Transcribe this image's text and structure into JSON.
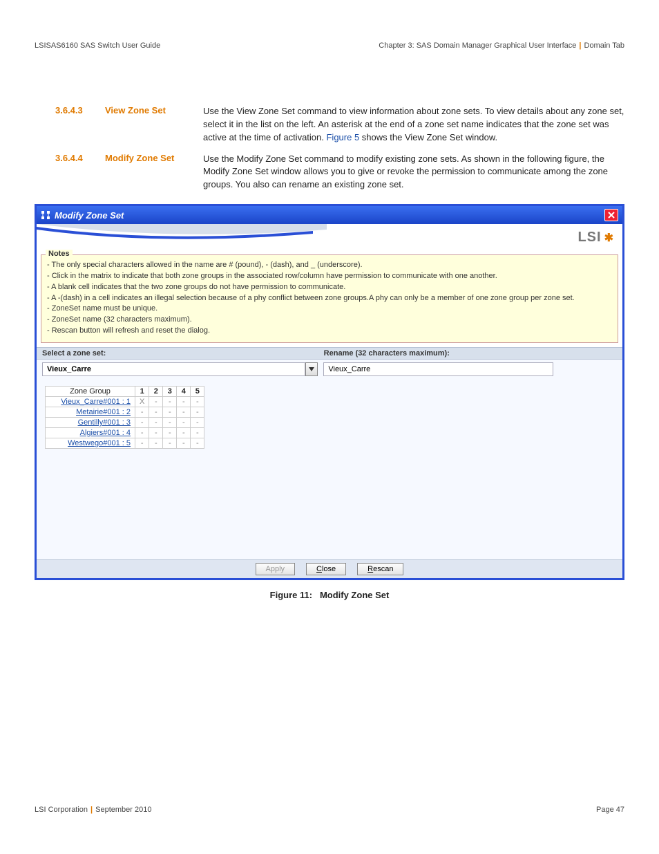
{
  "header": {
    "left": "LSISAS6160 SAS Switch User Guide",
    "right_chapter": "Chapter 3: SAS Domain Manager Graphical User Interface",
    "right_section": "Domain Tab"
  },
  "sections": [
    {
      "num": "3.6.4.3",
      "title": "View Zone Set",
      "body_pre": "Use the View Zone Set command to view information about zone sets. To view details about any zone set, select it in the list on the left. An asterisk at the end of a zone set name indicates that the zone set was active at the time of activation. ",
      "link": "Figure 5",
      "body_post": " shows the View Zone Set window."
    },
    {
      "num": "3.6.4.4",
      "title": "Modify Zone Set",
      "body_pre": "Use the Modify Zone Set command to modify existing zone sets. As shown in the following figure, the Modify Zone Set window allows you to give or revoke the permission to communicate among the zone groups. You also can rename an existing zone set.",
      "link": "",
      "body_post": ""
    }
  ],
  "dialog": {
    "title": "Modify Zone Set",
    "brand": "LSI",
    "notes_legend": "Notes",
    "notes": [
      "- The only special characters allowed in the name are # (pound), - (dash), and _ (underscore).",
      "- Click in the matrix to indicate that both zone groups in the associated row/column have permission to communicate with one another.",
      "- A blank cell indicates that the two zone groups do not have permission to communicate.",
      "- A -(dash) in a cell indicates an illegal selection because of a phy conflict between zone groups.A phy can only be a member of one zone group per zone set.",
      "- ZoneSet name must be unique.",
      "- ZoneSet name (32 characters maximum).",
      "- Rescan button will refresh and reset the dialog."
    ],
    "select_label": "Select a zone set:",
    "rename_label": "Rename (32 characters maximum):",
    "select_value": "Vieux_Carre",
    "rename_value": "Vieux_Carre",
    "matrix": {
      "header": "Zone Group",
      "cols": [
        "1",
        "2",
        "3",
        "4",
        "5"
      ],
      "rows": [
        {
          "label": "Vieux_Carre#001 : 1",
          "cells": [
            "X",
            "-",
            "-",
            "-",
            "-"
          ]
        },
        {
          "label": "Metairie#001 : 2",
          "cells": [
            "-",
            "-",
            "-",
            "-",
            "-"
          ]
        },
        {
          "label": "Gentilly#001 : 3",
          "cells": [
            "-",
            "-",
            "-",
            "-",
            "-"
          ]
        },
        {
          "label": "Algiers#001 : 4",
          "cells": [
            "-",
            "-",
            "-",
            "-",
            "-"
          ]
        },
        {
          "label": "Westwego#001 : 5",
          "cells": [
            "-",
            "-",
            "-",
            "-",
            "-"
          ]
        }
      ]
    },
    "buttons": {
      "apply": "Apply",
      "close": "Close",
      "rescan": "Rescan"
    }
  },
  "figure": {
    "num": "Figure 11:",
    "title": "Modify Zone Set"
  },
  "footer": {
    "left_a": "LSI Corporation",
    "left_b": "September 2010",
    "right": "Page 47"
  }
}
